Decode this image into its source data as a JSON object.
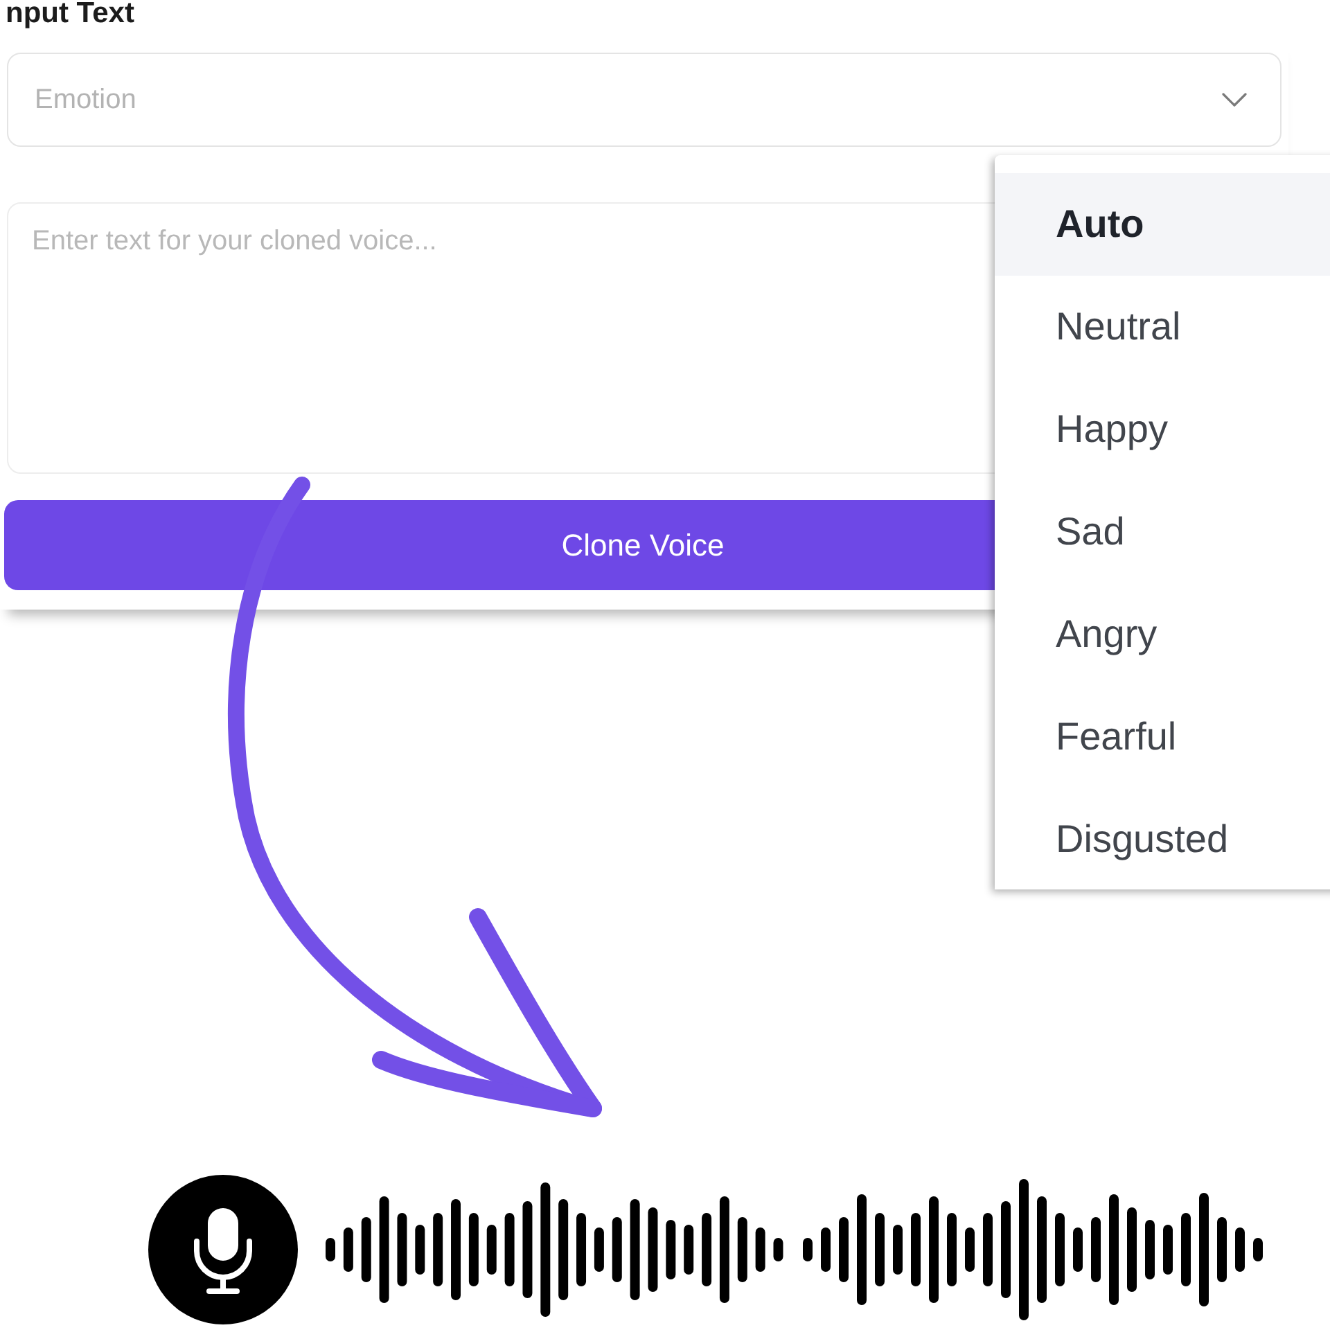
{
  "label": {
    "text": "nput Text"
  },
  "emotion_select": {
    "placeholder": "Emotion",
    "expanded": true
  },
  "text_input": {
    "placeholder": "Enter text for your cloned voice..."
  },
  "clone_button": {
    "label": "Clone Voice"
  },
  "emotion_menu": {
    "items": [
      {
        "label": "Auto",
        "selected": true
      },
      {
        "label": "Neutral",
        "selected": false
      },
      {
        "label": "Happy",
        "selected": false
      },
      {
        "label": "Sad",
        "selected": false
      },
      {
        "label": "Angry",
        "selected": false
      },
      {
        "label": "Fearful",
        "selected": false
      },
      {
        "label": "Disgusted",
        "selected": false
      }
    ]
  }
}
